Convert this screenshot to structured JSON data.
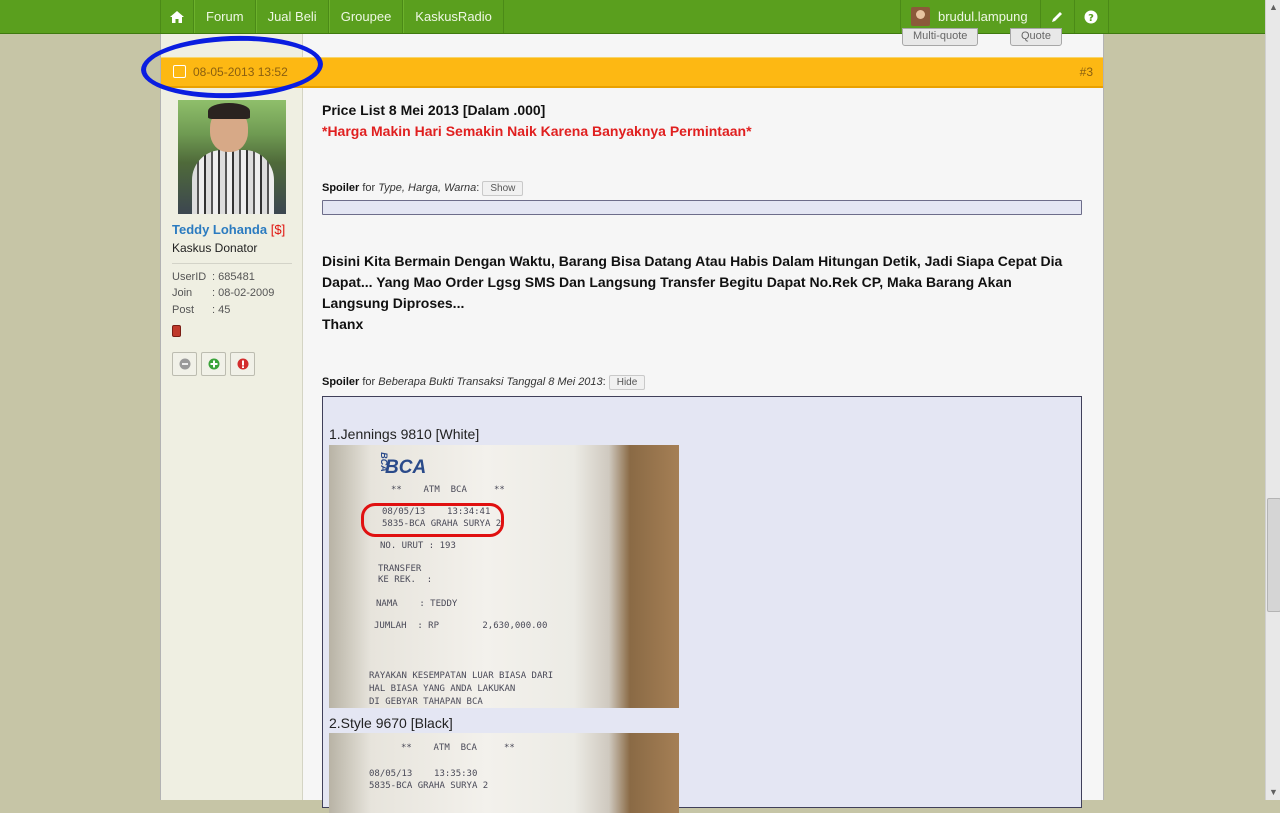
{
  "nav": {
    "items": [
      "Forum",
      "Jual Beli",
      "Groupee",
      "KaskusRadio"
    ],
    "username": "brudul.lampung"
  },
  "post": {
    "date": "08-05-2013 13:52",
    "number": "#3",
    "buttons": {
      "multi_quote": "Multi-quote",
      "quote": "Quote"
    }
  },
  "user": {
    "name": "Teddy Lohanda",
    "badge": "[$]",
    "title": "Kaskus Donator",
    "stats": [
      {
        "key": "UserID",
        "value": ": 685481"
      },
      {
        "key": "Join",
        "value": ": 08-02-2009"
      },
      {
        "key": "Post",
        "value": ": 45"
      }
    ]
  },
  "content": {
    "heading": "Price List 8 Mei 2013 [Dalam .000]",
    "subheading": "*Harga Makin Hari Semakin Naik Karena Banyaknya Permintaan*",
    "spoiler1": {
      "label": "Spoiler",
      "for_text": " for ",
      "title": "Type, Harga, Warna",
      "button": "Show"
    },
    "paragraph": "Disini Kita Bermain Dengan Waktu, Barang Bisa Datang Atau Habis Dalam Hitungan Detik, Jadi Siapa Cepat Dia Dapat... Yang Mao Order Lgsg SMS Dan Langsung Transfer Begitu Dapat No.Rek CP, Maka Barang Akan Langsung Diproses...",
    "thanks": "Thanx",
    "spoiler2": {
      "label": "Spoiler",
      "for_text": " for ",
      "title": "Beberapa Bukti Transaksi Tanggal 8 Mei 2013",
      "button": "Hide"
    },
    "items": [
      {
        "label": "1.Jennings 9810 [White]",
        "receipt": {
          "bank": "BCA",
          "atm": "**    ATM  BCA     **",
          "datetime": "08/05/13    13:34:41",
          "location": "5835-BCA GRAHA SURYA 2",
          "no_urut": "NO. URUT : 193",
          "transfer": "TRANSFER",
          "ke_rek": "KE REK.  :",
          "nama": "NAMA    : TEDDY",
          "jumlah": "JUMLAH  : RP        2,630,000.00",
          "footer1": "RAYAKAN KESEMPATAN LUAR BIASA DARI",
          "footer2": "HAL BIASA YANG ANDA LAKUKAN",
          "footer3": "DI GEBYAR TAHAPAN BCA"
        }
      },
      {
        "label": "2.Style 9670 [Black]",
        "receipt": {
          "atm": "**    ATM  BCA     **",
          "datetime": "08/05/13    13:35:30",
          "location": "5835-BCA GRAHA SURYA 2"
        }
      }
    ]
  }
}
